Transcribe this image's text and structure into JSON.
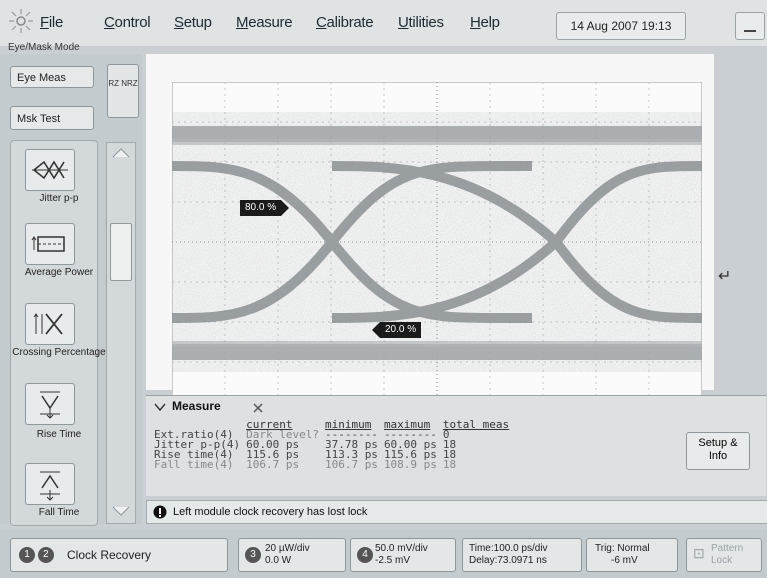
{
  "menu": {
    "items": [
      "File",
      "Control",
      "Setup",
      "Measure",
      "Calibrate",
      "Utilities",
      "Help"
    ],
    "datetime": "14 Aug 2007   19:13"
  },
  "left_panel": {
    "mode_label": "Eye/Mask Mode",
    "eye_meas": "Eye Meas",
    "msk_test": "Msk Test",
    "nrz_label": "RZ NRZ",
    "tools": [
      {
        "label": "Jitter p-p",
        "icon": "jitter-icon"
      },
      {
        "label": "Average Power",
        "icon": "average-power-icon"
      },
      {
        "label": "Crossing Percentage",
        "icon": "crossing-percentage-icon"
      },
      {
        "label": "Rise Time",
        "icon": "rise-time-icon"
      },
      {
        "label": "Fall Time",
        "icon": "fall-time-icon"
      }
    ]
  },
  "scope": {
    "marker_top": "80.0 %",
    "marker_bottom": "20.0 %",
    "trigger_marker": "↵"
  },
  "measure": {
    "tab_label": "Measure",
    "headers": [
      "current",
      "minimum",
      "maximum",
      "total meas"
    ],
    "rows": [
      {
        "name": "Ext.ratio(4)",
        "current": "Dark level?",
        "minimum": "--------",
        "maximum": "--------",
        "total": "0"
      },
      {
        "name": "Jitter p-p(4)",
        "current": "60.00 ps",
        "minimum": "37.78 ps",
        "maximum": "60.00 ps",
        "total": "18"
      },
      {
        "name": "Rise time(4)",
        "current": "115.6 ps",
        "minimum": "113.3 ps",
        "maximum": "115.6 ps",
        "total": "18"
      },
      {
        "name": "Fall time(4)",
        "current": "106.7 ps",
        "minimum": "106.7 ps",
        "maximum": "108.9 ps",
        "total": "18"
      }
    ],
    "setup_button": "Setup & Info"
  },
  "status": {
    "message": "Left module clock recovery has lost lock"
  },
  "bottom": {
    "clock_recovery": "Clock Recovery",
    "ch3_line1": "20 µW/div",
    "ch3_line2": "0.0 W",
    "ch4_line1": "50.0 mV/div",
    "ch4_line2": "-2.5 mV",
    "time_line1": "Time:100.0 ps/div",
    "time_line2": "Delay:73.0971 ns",
    "trig_line1": "Trig: Normal",
    "trig_line2": "-6 mV",
    "pattern_line1": "Pattern",
    "pattern_line2": "Lock"
  }
}
